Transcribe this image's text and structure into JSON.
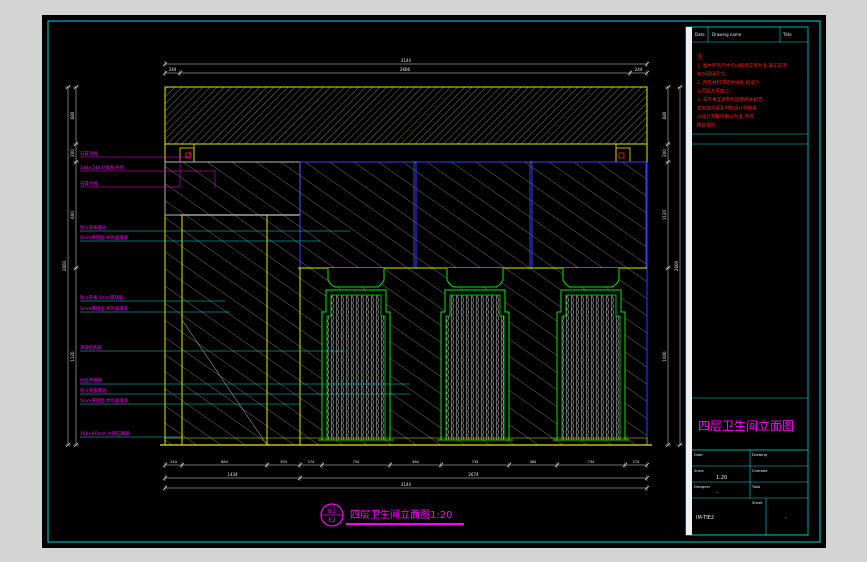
{
  "title_block": {
    "title": "四层卫生间立面图",
    "scale": "1:20",
    "dash": "-",
    "drawing_no": "IM-TIE2",
    "hdr_left": "Date",
    "hdr_mid": "Drawing name",
    "hdr_right": "Title",
    "row_labels": [
      "Date",
      "Drawing",
      "Scale",
      "Checked",
      "Designer",
      "Total",
      "Sheet"
    ],
    "notes_label": "注:",
    "notes": [
      "1. 图中所有尺寸均以现场实测为准,施工前须",
      "  核对现场尺寸。",
      "2. 所有材料须提供样板,经设计",
      "  认可后方可施工。",
      "3. 未尽事宜请参照国家相关规范,",
      "  如有疑问请及时与设计师联系,",
      "  以设计方最终确认为准,不得",
      "  擅自更改。"
    ]
  },
  "caption": {
    "badge": "B1",
    "badge_sub": "E2",
    "text": "四层卫生间立面图1:20"
  },
  "dimensions": {
    "top_total": "3144",
    "top_segments": [
      "244",
      "2666",
      "244"
    ],
    "bottom_row1": [
      "244",
      "884",
      "354",
      "274",
      "734",
      "484",
      "734",
      "484",
      "734",
      "274"
    ],
    "bottom_row2": [
      "1434",
      "2674"
    ],
    "bottom_total": "3144",
    "left_total": "2600",
    "left_segments": [
      "680",
      "200",
      "600",
      "1120"
    ],
    "right_total": "2600",
    "right_segments": [
      "680",
      "200",
      "1120",
      "1000"
    ]
  },
  "annotations": [
    "石膏顶线",
    "244×244 铝扣板吊顶",
    "石膏顶线",
    "防火夹板基层",
    "5mm厚镜面 木饰面清漆",
    "防火夹板 5mm厚镜面",
    "5mm厚镜面 木饰面清漆",
    "清玻结构胶",
    "拉丝不锈钢",
    "防火夹板基层",
    "5mm厚镜面 木饰面清漆",
    "100×60mm 大理石踢脚"
  ],
  "colors": {
    "frame_bg": "#000000",
    "frame_border": "#00d7d7",
    "outer_bg": "#d4d4d4",
    "yellow": "#e6e600",
    "green": "#00e600",
    "blue": "#3a3aff",
    "magenta": "#ff00ff",
    "red": "#ff2020",
    "white": "#e8e8e8",
    "cyan": "#00e0e0",
    "grey": "#9a9a9a"
  }
}
